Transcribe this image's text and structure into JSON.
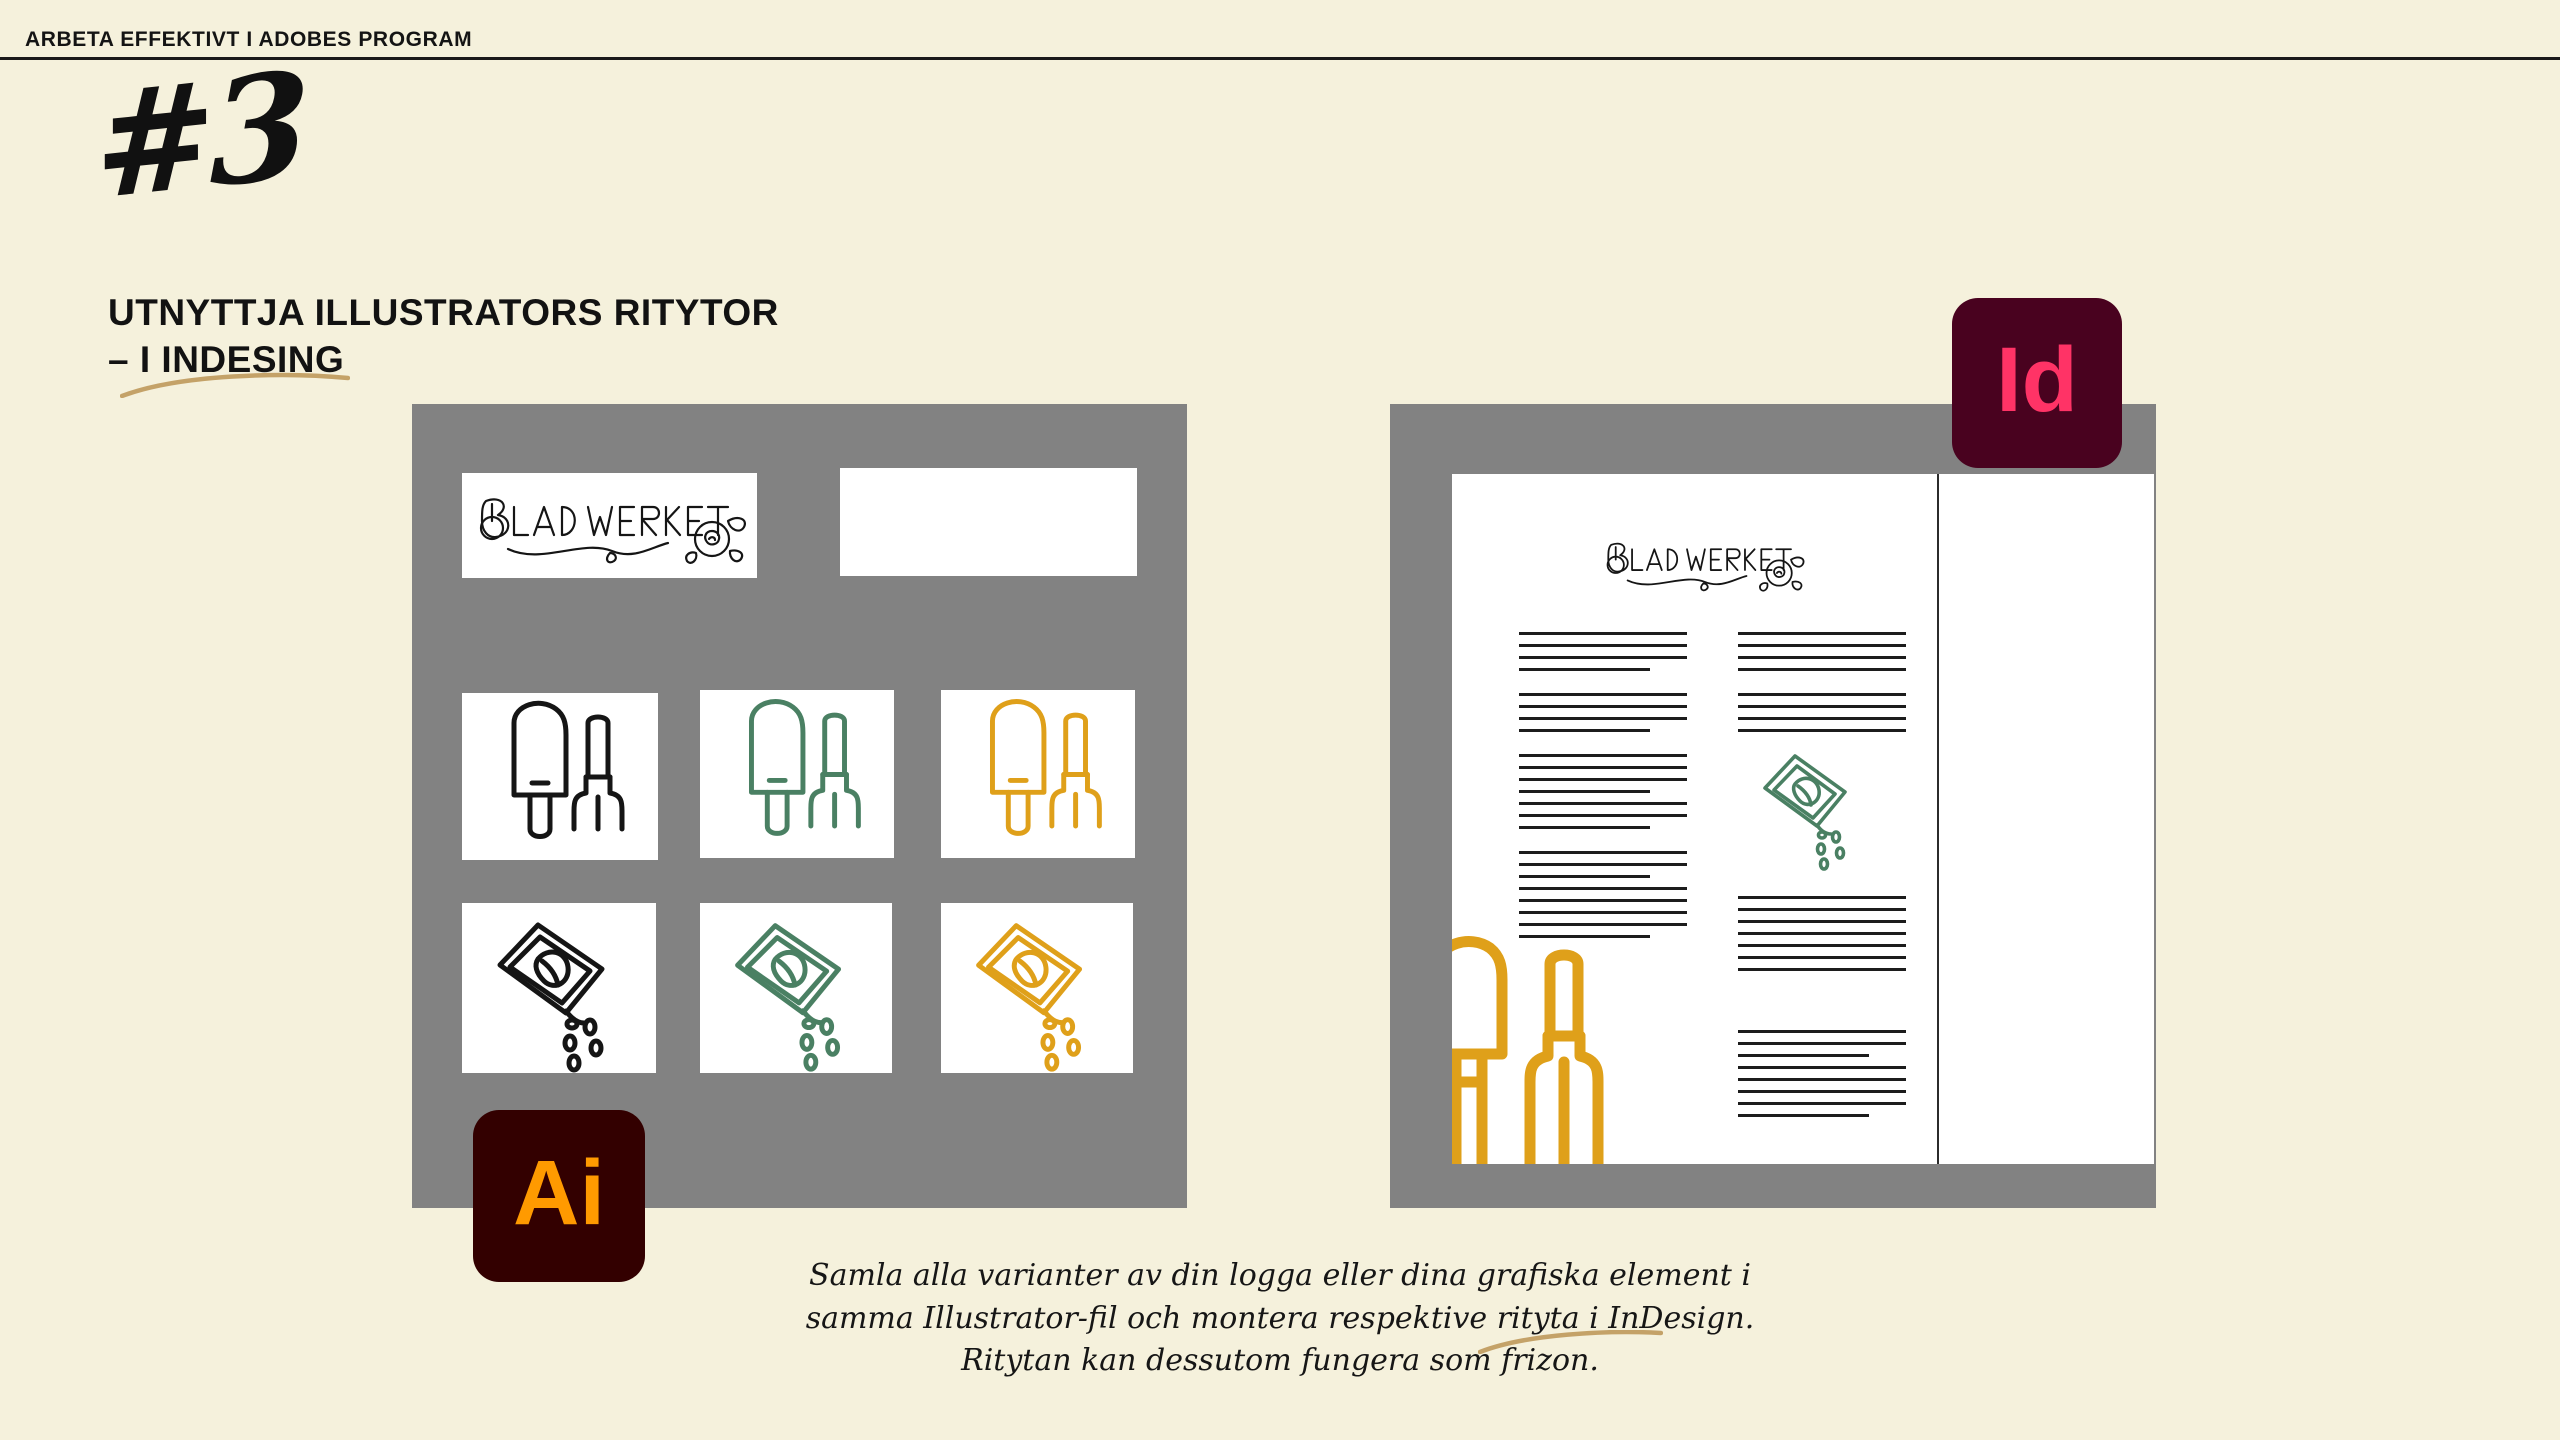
{
  "slide": {
    "eyebrow": "ARBETA EFFEKTIVT I ADOBES PROGRAM",
    "number_mark": "#3",
    "headline": "UTNYTTJA ILLUSTRATORS RITYTOR\n– I INDESING",
    "caption": "Samla alla varianter av din logga eller dina grafiska element i\nsamma Illustrator-fil och montera respektive rityta i InDesign.\nRitytan kan dessutom fungera som frizon."
  },
  "badges": {
    "illustrator": {
      "label": "Ai",
      "bg": "#330000",
      "fg": "#ff9a00"
    },
    "indesign": {
      "label": "Id",
      "bg": "#49021f",
      "fg": "#ff3366"
    }
  },
  "brand": {
    "logo_text": "BLADWERKET",
    "colors": {
      "page_bg": "#f5f1dc",
      "canvas_gray": "#828282",
      "artboard_white": "#ffffff",
      "ink_black": "#151515",
      "leaf_green": "#4a8063",
      "gold": "#dfa01a",
      "swoosh_tan": "#c4a268"
    }
  },
  "illustrator_panel": {
    "artboards": [
      {
        "name": "logo-artboard",
        "content": "BLADWERKET",
        "variant": "black"
      },
      {
        "name": "empty-artboard",
        "content": "",
        "variant": "empty"
      },
      {
        "name": "tools-artboard-black",
        "content": "trowel-and-fork",
        "variant": "black"
      },
      {
        "name": "tools-artboard-green",
        "content": "trowel-and-fork",
        "variant": "green"
      },
      {
        "name": "tools-artboard-gold",
        "content": "trowel-and-fork",
        "variant": "gold"
      },
      {
        "name": "seeds-artboard-black",
        "content": "seed-packet",
        "variant": "black"
      },
      {
        "name": "seeds-artboard-green",
        "content": "seed-packet",
        "variant": "green"
      },
      {
        "name": "seeds-artboard-gold",
        "content": "seed-packet",
        "variant": "gold"
      }
    ]
  },
  "indesign_panel": {
    "spread": {
      "logo_text": "BLADWERKET",
      "placed_graphics": [
        "seed-packet-green",
        "trowel-and-fork-gold"
      ],
      "columns": 2
    }
  }
}
